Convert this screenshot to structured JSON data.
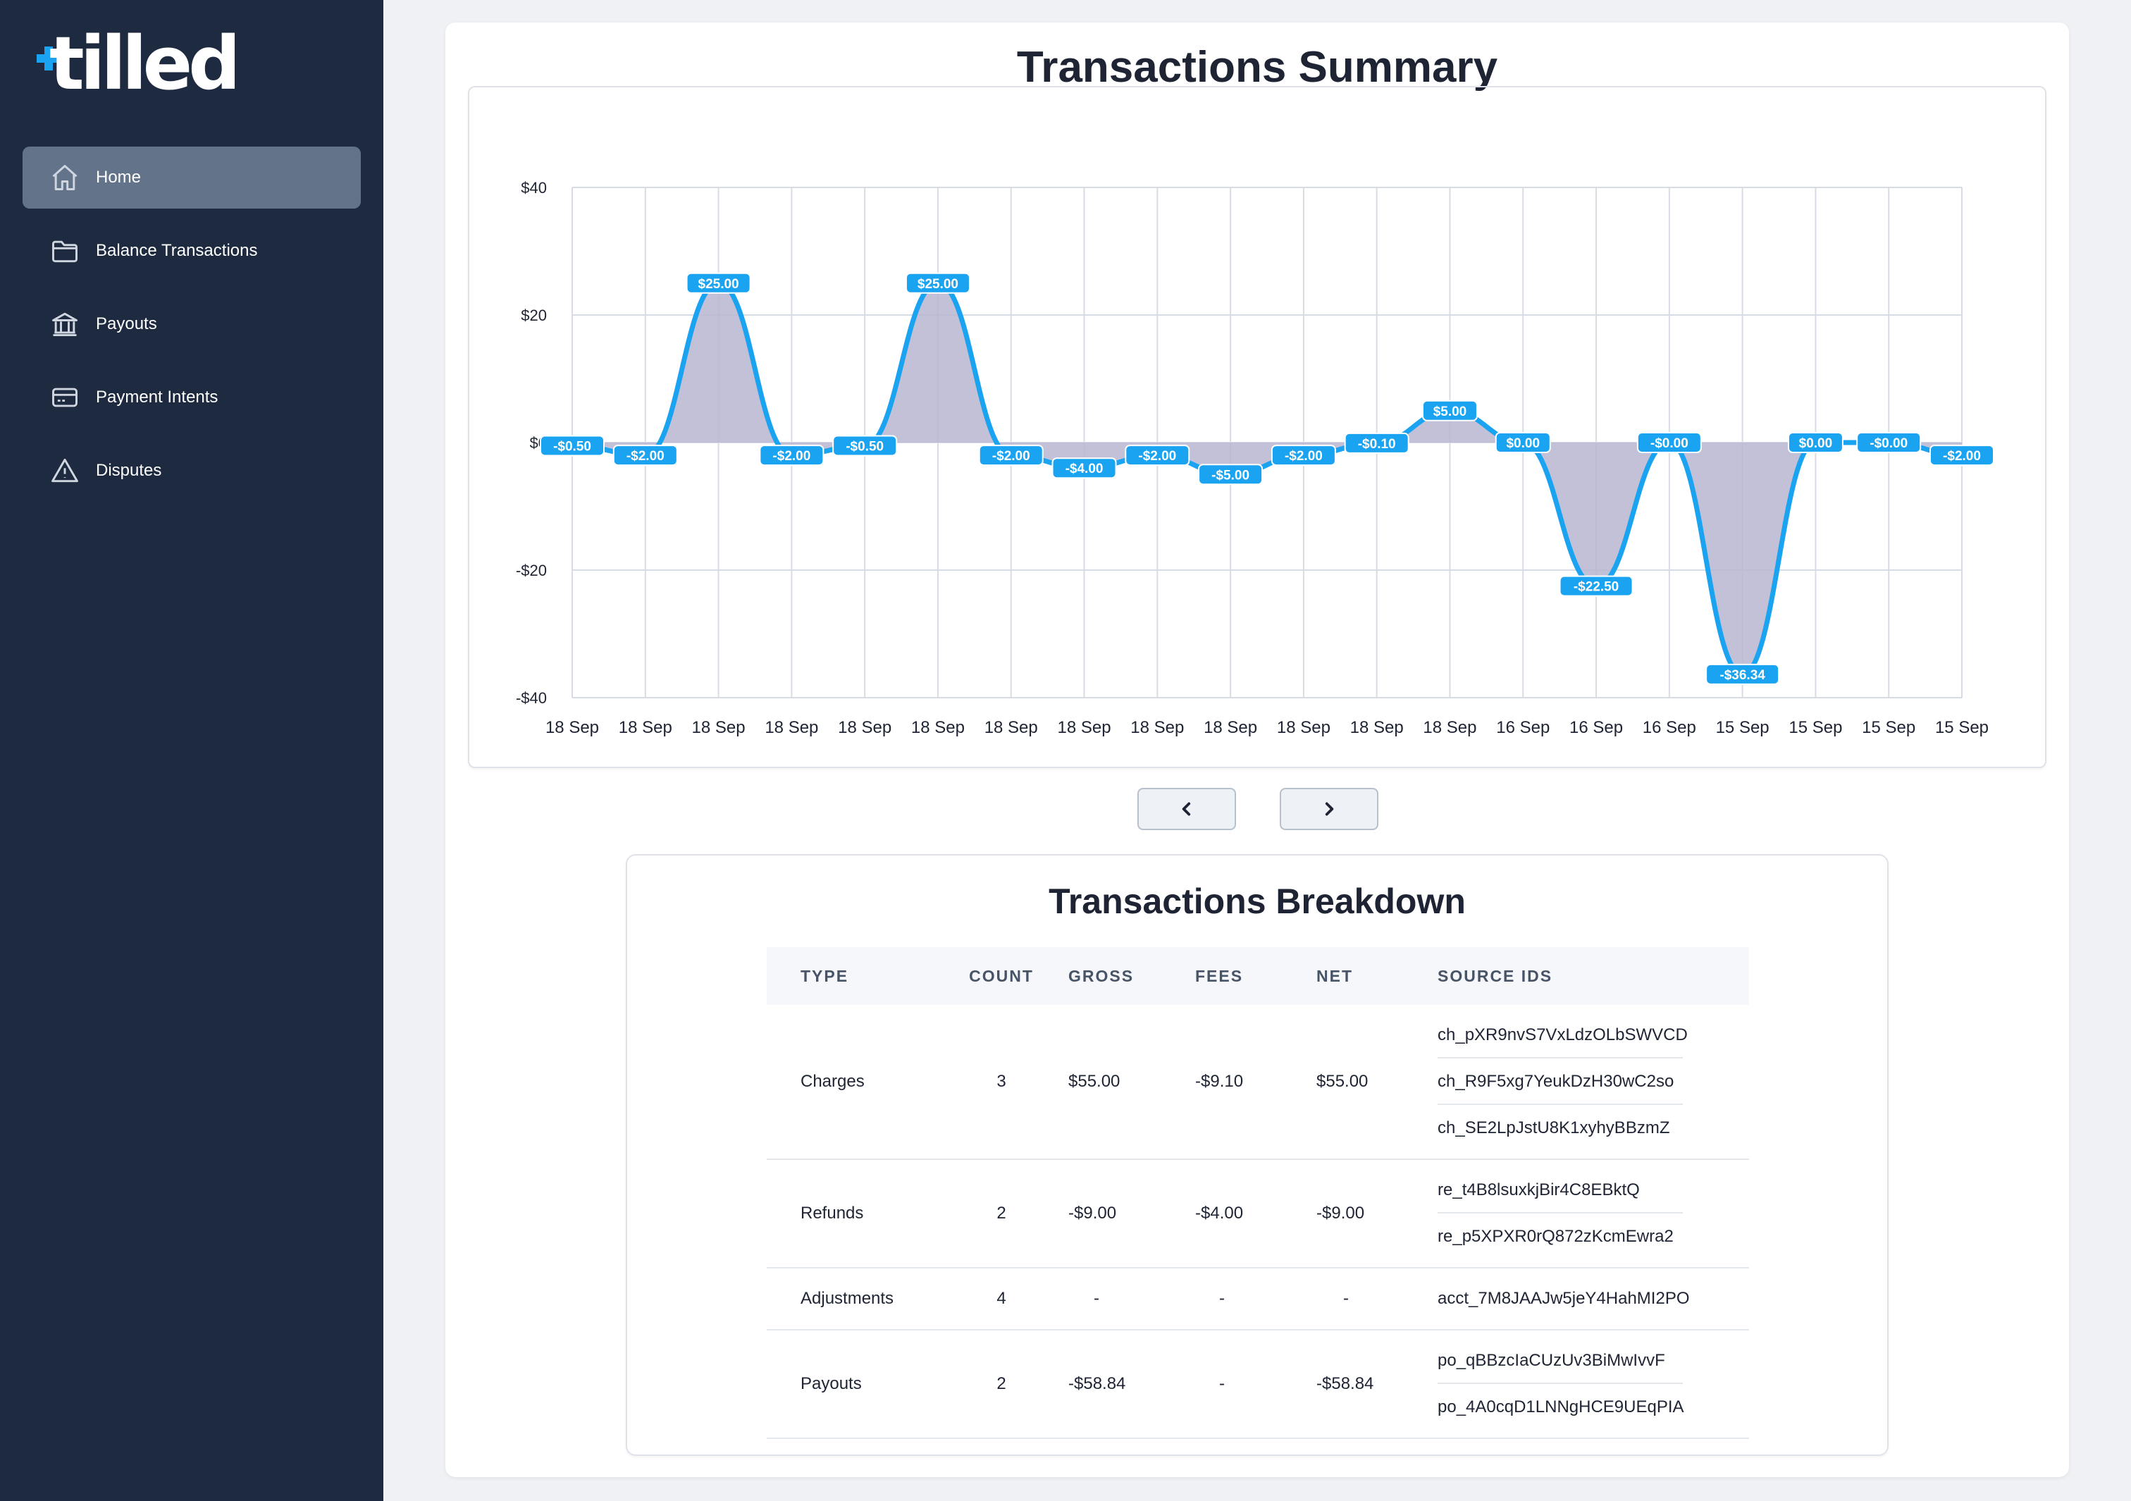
{
  "brand": {
    "name": "tilled",
    "accent": "#1aa3f0"
  },
  "sidebar": {
    "items": [
      {
        "label": "Home",
        "icon": "home-icon",
        "active": true
      },
      {
        "label": "Balance Transactions",
        "icon": "folder-icon",
        "active": false
      },
      {
        "label": "Payouts",
        "icon": "bank-icon",
        "active": false
      },
      {
        "label": "Payment Intents",
        "icon": "credit-card-icon",
        "active": false
      },
      {
        "label": "Disputes",
        "icon": "warning-icon",
        "active": false
      }
    ]
  },
  "summary": {
    "title": "Transactions Summary"
  },
  "pager": {
    "prev_icon": "chevron-left-icon",
    "next_icon": "chevron-right-icon"
  },
  "chart_data": {
    "type": "area",
    "x": [
      "18 Sep",
      "18 Sep",
      "18 Sep",
      "18 Sep",
      "18 Sep",
      "18 Sep",
      "18 Sep",
      "18 Sep",
      "18 Sep",
      "18 Sep",
      "18 Sep",
      "18 Sep",
      "18 Sep",
      "16 Sep",
      "16 Sep",
      "16 Sep",
      "15 Sep",
      "15 Sep",
      "15 Sep",
      "15 Sep"
    ],
    "values": [
      -0.5,
      -2,
      25,
      -2,
      -0.5,
      25,
      -2,
      -4,
      -2,
      -5,
      -2,
      -0.1,
      5,
      0,
      -22.5,
      0,
      -36.34,
      0,
      0,
      -2
    ],
    "labels": [
      "-$0.50",
      "-$2.00",
      "$25.00",
      "-$2.00",
      "-$0.50",
      "$25.00",
      "-$2.00",
      "-$4.00",
      "-$2.00",
      "-$5.00",
      "-$2.00",
      "-$0.10",
      "$5.00",
      "$0.00",
      "-$22.50",
      "-$0.00",
      "-$36.34",
      "$0.00",
      "-$0.00",
      "-$2.00"
    ],
    "yticks": [
      "$40",
      "$20",
      "$0",
      "-$20",
      "-$40"
    ],
    "ylim": [
      -40,
      40
    ],
    "grid": true,
    "line_color": "#1aa3f0",
    "fill_color": "#b7b6d1",
    "label_bg": "#1aa3f0"
  },
  "breakdown": {
    "title": "Transactions Breakdown",
    "columns": [
      "TYPE",
      "COUNT",
      "GROSS",
      "FEES",
      "NET",
      "SOURCE IDS"
    ],
    "rows": [
      {
        "type": "Charges",
        "count": "3",
        "gross": "$55.00",
        "fees": "-$9.10",
        "net": "$55.00",
        "sources": [
          "ch_pXR9nvS7VxLdzOLbSWVCD",
          "ch_R9F5xg7YeukDzH30wC2so",
          "ch_SE2LpJstU8K1xyhyBBzmZ"
        ]
      },
      {
        "type": "Refunds",
        "count": "2",
        "gross": "-$9.00",
        "fees": "-$4.00",
        "net": "-$9.00",
        "sources": [
          "re_t4B8lsuxkjBir4C8EBktQ",
          "re_p5XPXR0rQ872zKcmEwra2"
        ]
      },
      {
        "type": "Adjustments",
        "count": "4",
        "gross": "-",
        "fees": "-",
        "net": "-",
        "sources": [
          "acct_7M8JAAJw5jeY4HahMI2PO"
        ]
      },
      {
        "type": "Payouts",
        "count": "2",
        "gross": "-$58.84",
        "fees": "-",
        "net": "-$58.84",
        "sources": [
          "po_qBBzcIaCUzUv3BiMwIvvF",
          "po_4A0cqD1LNNgHCE9UEqPIA"
        ]
      }
    ]
  }
}
